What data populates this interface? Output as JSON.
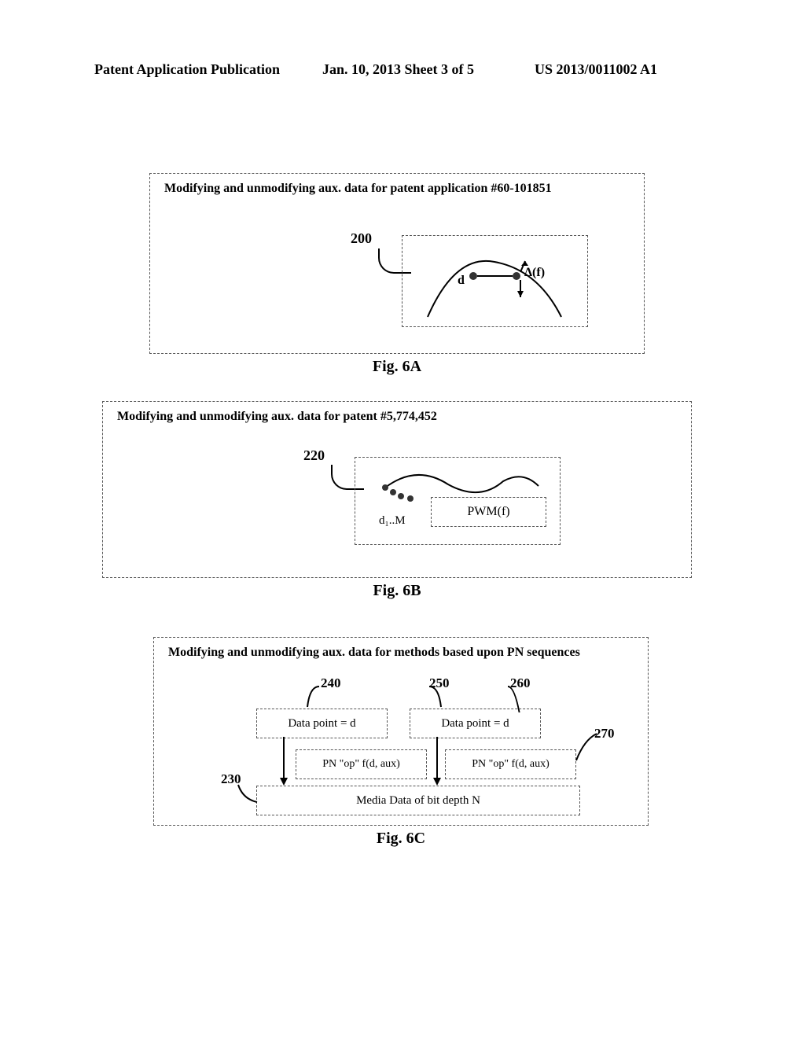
{
  "header": {
    "left": "Patent Application Publication",
    "middle": "Jan. 10, 2013  Sheet 3 of 5",
    "right": "US 2013/0011002 A1"
  },
  "fig6a": {
    "box_title": "Modifying and unmodifying  aux. data for patent application #60-101851",
    "ref200": "200",
    "d_label": "d",
    "delta_label": "Δ(f)",
    "caption": "Fig. 6A"
  },
  "fig6b": {
    "box_title": "Modifying and unmodifying aux. data for patent #5,774,452",
    "ref220": "220",
    "pwm_label": "PWM(f)",
    "d1m_label": "d₁..M",
    "caption": "Fig. 6B"
  },
  "fig6c": {
    "box_title": "Modifying and unmodifying aux. data for methods based upon PN sequences",
    "dp1": "Data point = d",
    "dp2": "Data point = d",
    "pn1": "PN \"op\" f(d, aux)",
    "pn2": "PN \"op\" f(d, aux)",
    "media": "Media Data of bit depth N",
    "ref240": "240",
    "ref250": "250",
    "ref260": "260",
    "ref270": "270",
    "ref230": "230",
    "caption": "Fig. 6C"
  }
}
